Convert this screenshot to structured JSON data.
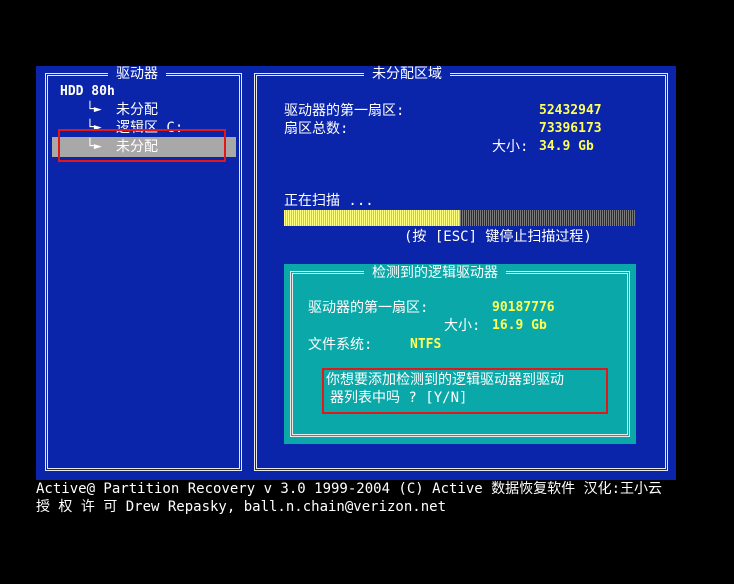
{
  "colors": {
    "panel": "#0a24aa",
    "accent": "#ffff55",
    "dialog": "#0aa8a8",
    "highlight": "#a8a8a8",
    "annotation": "#e01818"
  },
  "drives_panel": {
    "title": "驱动器",
    "root": "HDD 80h",
    "items": [
      {
        "label": "未分配",
        "selected": false
      },
      {
        "label": "逻辑区  C:",
        "selected": false
      },
      {
        "label": "未分配",
        "selected": true
      }
    ]
  },
  "region_panel": {
    "title": "未分配区域",
    "first_sector_label": "驱动器的第一扇区:",
    "first_sector_value": "52432947",
    "total_sectors_label": "扇区总数:",
    "total_sectors_value": "73396173",
    "size_label": "大小:",
    "size_value": "34.9 Gb",
    "scan_label": "正在扫描 ...",
    "scan_progress": 0.5,
    "esc_hint": "(按 [ESC] 键停止扫描过程)"
  },
  "detect_dialog": {
    "title": "检测到的逻辑驱动器",
    "first_sector_label": "驱动器的第一扇区:",
    "first_sector_value": "90187776",
    "size_label": "大小:",
    "size_value": "16.9 Gb",
    "fs_label": "文件系统:",
    "fs_value": "NTFS",
    "question_line1": "你想要添加检测到的逻辑驱动器到驱动",
    "question_line2": "器列表中吗 ? [Y/N]"
  },
  "footer": {
    "line1": "Active@ Partition Recovery v 3.0   1999-2004 (C) Active 数据恢复软件 汉化:王小云",
    "line2": "授 权 许 可 Drew Repasky, ball.n.chain@verizon.net"
  }
}
